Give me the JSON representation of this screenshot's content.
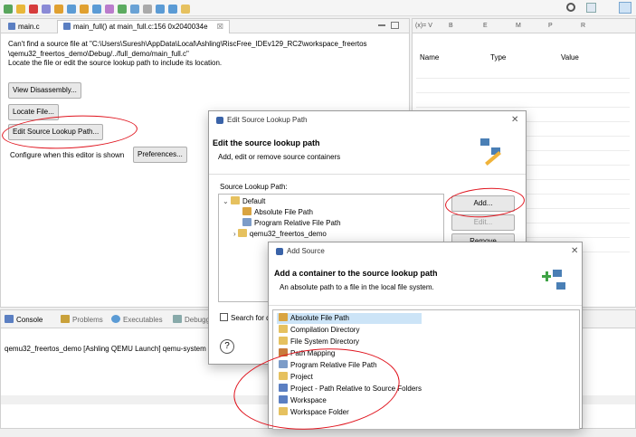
{
  "editor": {
    "tab_main": "main.c",
    "tab_active": "main_full() at main_full.c:156 0x2040034e",
    "tab_close": "☒",
    "message_line1": "Can't find a source file at \"C:\\Users\\Suresh\\AppData\\Local\\Ashling\\RiscFree_IDEv129_RC2\\workspace_freertos",
    "message_line2": "\\qemu32_freertos_demo\\Debug/../full_demo/main_full.c\"",
    "message_line3": "Locate the file or edit the source lookup path to include its location.",
    "btn_disassembly": "View Disassembly...",
    "btn_locate": "Locate File...",
    "btn_edit_lookup": "Edit Source Lookup Path...",
    "configure_text": "Configure when this editor is shown",
    "btn_preferences": "Preferences..."
  },
  "variables": {
    "tabs": [
      "(x)= V",
      "B",
      "E",
      "M",
      "P",
      "R"
    ],
    "col_name": "Name",
    "col_type": "Type",
    "col_value": "Value"
  },
  "console": {
    "tabs": [
      "Console",
      "Problems",
      "Executables",
      "Debugg"
    ],
    "line": "qemu32_freertos_demo [Ashling QEMU Launch] qemu-system"
  },
  "edit_dialog": {
    "window_title": "Edit Source Lookup Path",
    "heading": "Edit the source lookup path",
    "subtitle": "Add, edit or remove source containers",
    "list_label": "Source Lookup Path:",
    "tree": [
      "Default",
      "Absolute File Path",
      "Program Relative File Path",
      "qemu32_freertos_demo"
    ],
    "btn_add": "Add...",
    "btn_edit": "Edit...",
    "btn_remove": "Remove",
    "search_label": "Search for d",
    "help": "?",
    "close": "✕"
  },
  "add_dialog": {
    "window_title": "Add Source",
    "heading": "Add a container to the source lookup path",
    "subtitle": "An absolute path to a file in the local file system.",
    "close": "✕",
    "items": [
      "Absolute File Path",
      "Compilation Directory",
      "File System Directory",
      "Path Mapping",
      "Program Relative File Path",
      "Project",
      "Project - Path Relative to Source Folders",
      "Workspace",
      "Workspace Folder"
    ]
  },
  "colors": {
    "accent": "#0078d7",
    "annotation": "#e0141e"
  }
}
